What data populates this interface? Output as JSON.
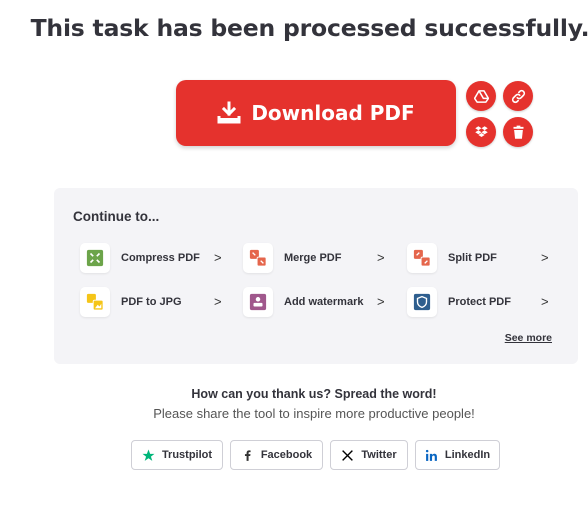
{
  "header": {
    "title": "This task has been processed successfully."
  },
  "download": {
    "label": "Download PDF"
  },
  "side_actions": [
    {
      "icon": "google-drive-icon"
    },
    {
      "icon": "link-icon"
    },
    {
      "icon": "dropbox-icon"
    },
    {
      "icon": "trash-icon"
    }
  ],
  "continue": {
    "title": "Continue to...",
    "tools": [
      {
        "label": "Compress PDF",
        "icon": "compress-icon",
        "color": "#6ca44a"
      },
      {
        "label": "Merge PDF",
        "icon": "merge-icon",
        "color": "#e5664c"
      },
      {
        "label": "Split PDF",
        "icon": "split-icon",
        "color": "#e5664c"
      },
      {
        "label": "PDF to JPG",
        "icon": "image-icon",
        "color": "#f5c518"
      },
      {
        "label": "Add watermark",
        "icon": "watermark-icon",
        "color": "#a0588c"
      },
      {
        "label": "Protect PDF",
        "icon": "shield-icon",
        "color": "#2e5e8e"
      }
    ],
    "chevron": ">",
    "see_more": "See more"
  },
  "share": {
    "heading": "How can you thank us? Spread the word!",
    "subheading": "Please share the tool to inspire more productive people!",
    "buttons": [
      {
        "label": "Trustpilot",
        "icon": "star-icon",
        "color": "#00b67a"
      },
      {
        "label": "Facebook",
        "icon": "facebook-icon",
        "color": "#1877f2"
      },
      {
        "label": "Twitter",
        "icon": "x-icon",
        "color": "#000000"
      },
      {
        "label": "LinkedIn",
        "icon": "linkedin-icon",
        "color": "#0a66c2"
      }
    ]
  },
  "colors": {
    "accent": "#e5322d",
    "panel_bg": "#f4f4f7",
    "text": "#33333b"
  }
}
